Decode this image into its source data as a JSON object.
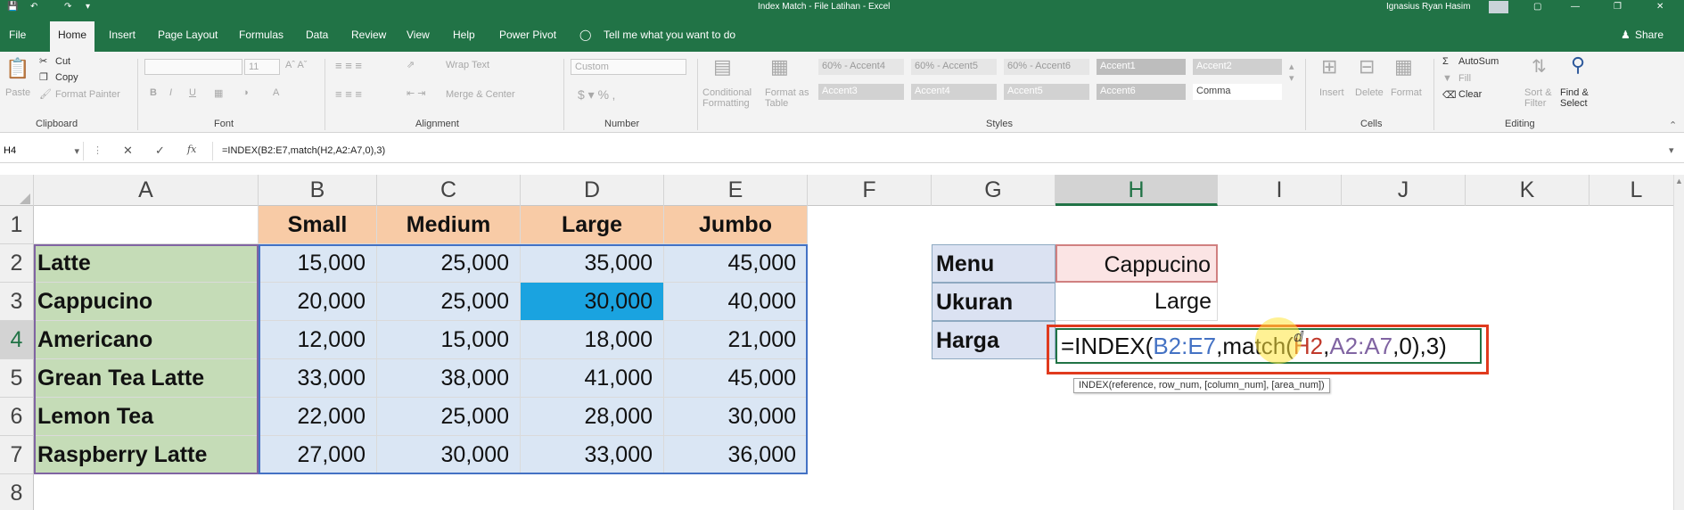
{
  "window": {
    "title": "Index Match - File Latihan  -  Excel",
    "user": "Ignasius Ryan Hasim"
  },
  "tabs": [
    "File",
    "Home",
    "Insert",
    "Page Layout",
    "Formulas",
    "Data",
    "Review",
    "View",
    "Help",
    "Power Pivot"
  ],
  "tell_me": "Tell me what you want to do",
  "share": "Share",
  "clipboard": {
    "paste": "Paste",
    "cut": "Cut",
    "copy": "Copy",
    "format_painter": "Format Painter",
    "group": "Clipboard"
  },
  "font": {
    "size": "11",
    "group": "Font"
  },
  "alignment": {
    "wrap": "Wrap Text",
    "merge": "Merge & Center",
    "group": "Alignment"
  },
  "number": {
    "format": "Custom",
    "group": "Number"
  },
  "styles": {
    "conditional": "Conditional Formatting",
    "format_table": "Format as Table",
    "cells": [
      "60% - Accent4",
      "60% - Accent5",
      "60% - Accent6",
      "Accent1",
      "Accent2",
      "Accent3",
      "Accent4",
      "Accent5",
      "Accent6",
      "Comma"
    ],
    "group": "Styles"
  },
  "cells_group": {
    "insert": "Insert",
    "delete": "Delete",
    "format": "Format",
    "group": "Cells"
  },
  "editing": {
    "autosum": "AutoSum",
    "fill": "Fill",
    "clear": "Clear",
    "sort": "Sort & Filter",
    "find": "Find & Select",
    "group": "Editing"
  },
  "formula_bar": {
    "name_box": "H4",
    "formula": "=INDEX(B2:E7,match(H2,A2:A7,0),3)"
  },
  "columns": [
    "A",
    "B",
    "C",
    "D",
    "E",
    "F",
    "G",
    "H",
    "I",
    "J",
    "K",
    "L"
  ],
  "rows": [
    "1",
    "2",
    "3",
    "4",
    "5",
    "6",
    "7",
    "8"
  ],
  "table": {
    "headers": [
      "Small",
      "Medium",
      "Large",
      "Jumbo"
    ],
    "menu": [
      "Latte",
      "Cappucino",
      "Americano",
      "Grean Tea Latte",
      "Lemon Tea",
      "Raspberry Latte"
    ],
    "values": [
      [
        "15,000",
        "25,000",
        "35,000",
        "45,000"
      ],
      [
        "20,000",
        "25,000",
        "30,000",
        "40,000"
      ],
      [
        "12,000",
        "15,000",
        "18,000",
        "21,000"
      ],
      [
        "33,000",
        "38,000",
        "41,000",
        "45,000"
      ],
      [
        "22,000",
        "25,000",
        "28,000",
        "30,000"
      ],
      [
        "27,000",
        "30,000",
        "33,000",
        "36,000"
      ]
    ]
  },
  "lookup": {
    "labels": [
      "Menu",
      "Ukuran",
      "Harga"
    ],
    "menu_value": "Cappucino",
    "size_value": "Large",
    "formula_parts": [
      "=INDEX(",
      "B2:E7",
      ",match(",
      "H2",
      ",",
      "A2:A7",
      ",0)",
      ",3)"
    ]
  },
  "tooltip": "INDEX(reference, row_num, [column_num], [area_num])",
  "colors": {
    "excel_green": "#217346",
    "header_fill": "#f8cba6",
    "menu_fill": "#c5dcb7",
    "highlight": "#1aa3e0",
    "edit_border": "#e03a1e"
  }
}
